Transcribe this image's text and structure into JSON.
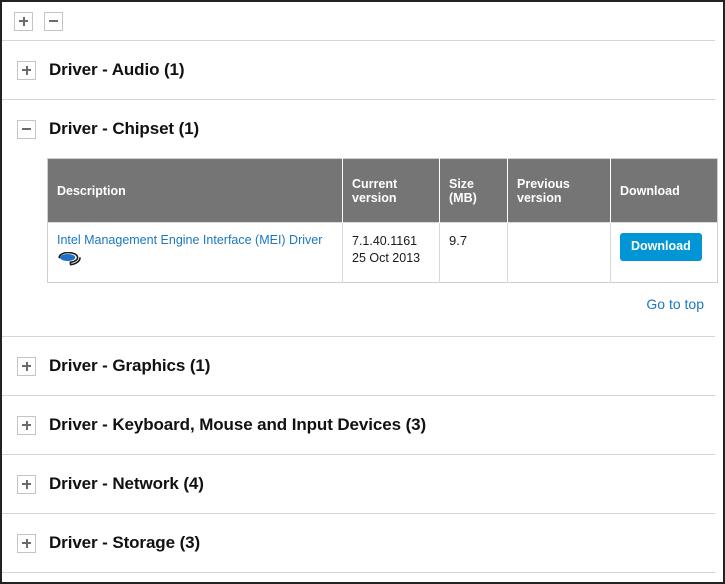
{
  "toolbar": {
    "expand_all_label": "+",
    "collapse_all_label": "−",
    "expand_all_name": "expand-all",
    "collapse_all_name": "collapse-all"
  },
  "colors": {
    "accent_blue": "#0096d6",
    "link_blue": "#1b77bf",
    "table_header_gray": "#757575",
    "border_gray": "#cfcfcf",
    "divider_gray": "#d6d6d6"
  },
  "sections": [
    {
      "title": "Driver - Audio (1)",
      "expanded": false,
      "toggle": "+"
    },
    {
      "title": "Driver - Chipset (1)",
      "expanded": true,
      "toggle": "−"
    },
    {
      "title": "Driver - Graphics (1)",
      "expanded": false,
      "toggle": "+"
    },
    {
      "title": "Driver - Keyboard, Mouse and Input Devices (3)",
      "expanded": false,
      "toggle": "+"
    },
    {
      "title": "Driver - Network (4)",
      "expanded": false,
      "toggle": "+"
    },
    {
      "title": "Driver - Storage (3)",
      "expanded": false,
      "toggle": "+"
    }
  ],
  "table": {
    "headers": {
      "description": "Description",
      "current_version": "Current version",
      "size": "Size (MB)",
      "previous_version": "Previous version",
      "download": "Download"
    },
    "rows": [
      {
        "description": "Intel Management Engine Interface (MEI) Driver",
        "icon": "driver-disc-icon",
        "current_version": "7.1.40.1161",
        "release_date": "25 Oct 2013",
        "size": "9.7",
        "previous_version": "",
        "download_label": "Download"
      }
    ]
  },
  "links": {
    "go_to_top": "Go to top"
  }
}
